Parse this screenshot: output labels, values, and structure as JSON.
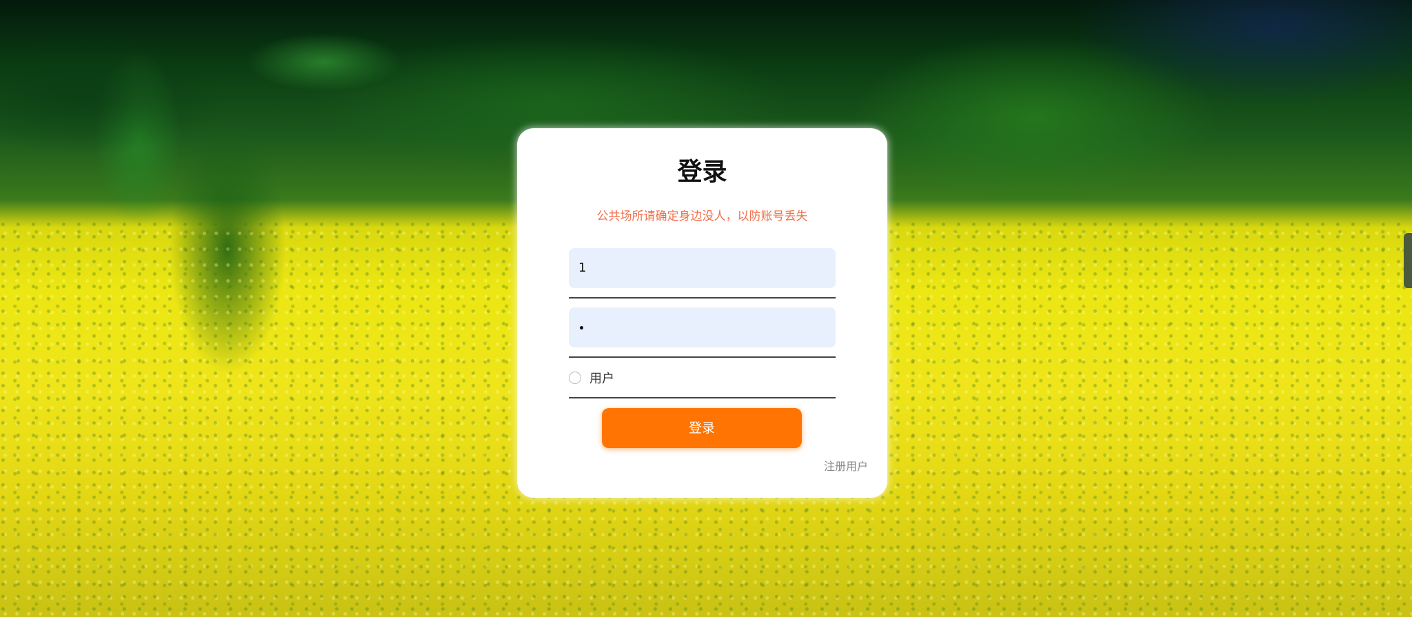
{
  "login": {
    "title": "登录",
    "notice": "公共场所请确定身边没人，以防账号丢失",
    "username_value": "1",
    "password_masked": true,
    "role_label": "用户",
    "submit_label": "登录",
    "register_label": "注册用户"
  },
  "colors": {
    "accent": "#ff7402",
    "notice": "#f0704a",
    "input_bg": "#e8f0fe"
  }
}
